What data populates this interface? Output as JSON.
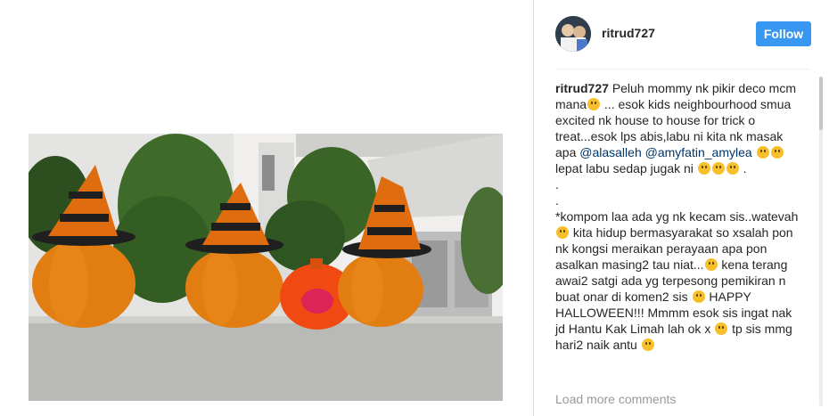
{
  "post": {
    "username": "ritrud727",
    "follow_label": "Follow"
  },
  "caption": {
    "username": "ritrud727",
    "seg1": "Peluh mommy nk pikir deco mcm mana",
    "seg2": " ... esok kids neighbourhood smua excited nk house to house for trick o treat...esok lps abis,labu ni kita nk masak apa ",
    "mention1": "@alasalleh",
    "mention2": "@amyfatin_amylea",
    "seg3": " lepat labu sedap jugak ni ",
    "seg3b": " .",
    "dot1": ".",
    "dot2": ".",
    "seg4": "*kompom laa ada yg nk kecam sis..watevah ",
    "seg5": " kita hidup bermasyarakat so xsalah pon nk kongsi meraikan perayaan apa pon asalkan masing2 tau niat...",
    "seg6": " kena terang awai2 satgi ada yg terpesong pemikiran n buat onar di komen2 sis ",
    "seg7": " HAPPY HALLOWEEN!!! Mmmm esok sis ingat nak jd Hantu Kak Limah lah ok x ",
    "seg8": " tp sis mmg hari2 naik antu "
  },
  "load_more": "Load more comments",
  "colors": {
    "follow_button": "#3897f0",
    "mention": "#003569",
    "username": "#262626",
    "muted": "#999999"
  },
  "icons": [
    "emoji-icon"
  ]
}
